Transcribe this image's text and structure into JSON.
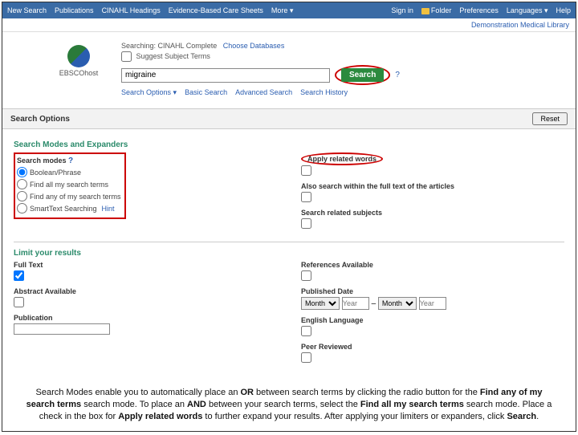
{
  "nav": {
    "new_search": "New Search",
    "publications": "Publications",
    "headings": "CINAHL Headings",
    "ecs": "Evidence-Based Care Sheets",
    "more": "More ▾",
    "signin": "Sign in",
    "folder": "Folder",
    "prefs": "Preferences",
    "lang": "Languages ▾",
    "help": "Help"
  },
  "subbar": {
    "demo": "Demonstration Medical Library"
  },
  "logo": {
    "text": "EBSCOhost"
  },
  "search": {
    "searching_label": "Searching:",
    "db": "CINAHL Complete",
    "choose": "Choose Databases",
    "suggest": "Suggest Subject Terms",
    "value": "migraine",
    "btn": "Search",
    "q": "?",
    "opt": "Search Options ▾",
    "basic": "Basic Search",
    "adv": "Advanced Search",
    "hist": "Search History"
  },
  "options": {
    "title": "Search Options",
    "reset": "Reset",
    "modes_head": "Search Modes and Expanders",
    "modes_label": "Search modes",
    "q": "?",
    "m1": "Boolean/Phrase",
    "m2": "Find all my search terms",
    "m3": "Find any of my search terms",
    "m4": "SmartText Searching",
    "hint": "Hint",
    "apply_related": "Apply related words",
    "fulltext_search": "Also search within the full text of the articles",
    "related_subj": "Search related subjects",
    "limit_head": "Limit your results",
    "fulltext": "Full Text",
    "abstract": "Abstract Available",
    "publication": "Publication",
    "references": "References Available",
    "pubdate": "Published Date",
    "month": "Month",
    "year": "Year",
    "dash": "–",
    "english": "English Language",
    "peer": "Peer Reviewed"
  },
  "caption": {
    "t1": "Search Modes enable you to automatically place an ",
    "b1": "OR",
    "t2": " between search terms by clicking the radio button for the ",
    "b2": "Find any of my search terms",
    "t3": " search mode. To place an ",
    "b3": "AND",
    "t4": " between your search terms, select the ",
    "b4": "Find all my search terms",
    "t5": " search mode. Place a check in the box for ",
    "b5": "Apply related words",
    "t6": " to further expand your results. After applying your limiters or expanders, click ",
    "b6": "Search",
    "t7": "."
  }
}
